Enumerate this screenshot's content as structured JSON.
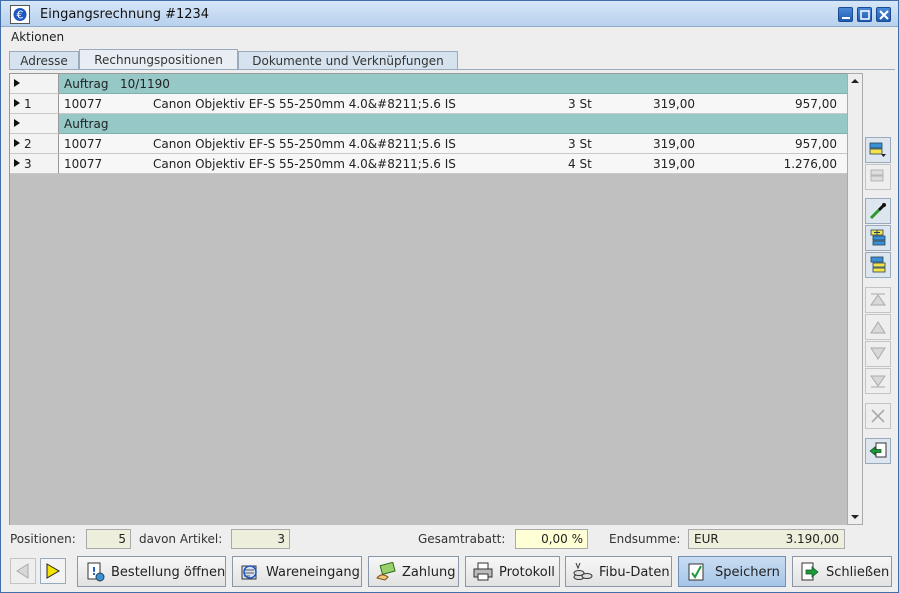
{
  "window": {
    "title": "Eingangsrechnung #1234"
  },
  "menu": {
    "actions": "Aktionen"
  },
  "tabs": [
    {
      "label": "Adresse"
    },
    {
      "label": "Rechnungspositionen"
    },
    {
      "label": "Dokumente und Verknüpfungen"
    }
  ],
  "grid": {
    "groups": [
      {
        "label": "Auftrag",
        "number": "10/1190"
      },
      {
        "label": "Auftrag",
        "number": ""
      }
    ],
    "items": [
      {
        "pos": "1",
        "article": "10077",
        "description": "Canon Objektiv EF-S 55-250mm 4.0&#8211;5.6 IS",
        "quantity": "3 St",
        "price": "319,00",
        "total": "957,00"
      },
      {
        "pos": "2",
        "article": "10077",
        "description": "Canon Objektiv EF-S 55-250mm 4.0&#8211;5.6 IS",
        "quantity": "3 St",
        "price": "319,00",
        "total": "957,00"
      },
      {
        "pos": "3",
        "article": "10077",
        "description": "Canon Objektiv EF-S 55-250mm 4.0&#8211;5.6 IS",
        "quantity": "4 St",
        "price": "319,00",
        "total": "1.276,00"
      }
    ]
  },
  "footer": {
    "positions_label": "Positionen:",
    "positions_value": "5",
    "articles_label": "davon Artikel:",
    "articles_value": "3",
    "discount_label": "Gesamtrabatt:",
    "discount_value": "0,00 %",
    "total_label": "Endsumme:",
    "currency": "EUR",
    "total_value": "3.190,00"
  },
  "actions": {
    "open_order": "Bestellung öffnen",
    "goods_receipt": "Wareneingang",
    "payment": "Zahlung",
    "protocol": "Protokoll",
    "fibu": "Fibu-Daten",
    "save": "Speichern",
    "close": "Schließen"
  },
  "colors": {
    "group_row": "#96c8c8",
    "grid_bg": "#c0c0c0",
    "discount_field": "#ffffd6"
  }
}
